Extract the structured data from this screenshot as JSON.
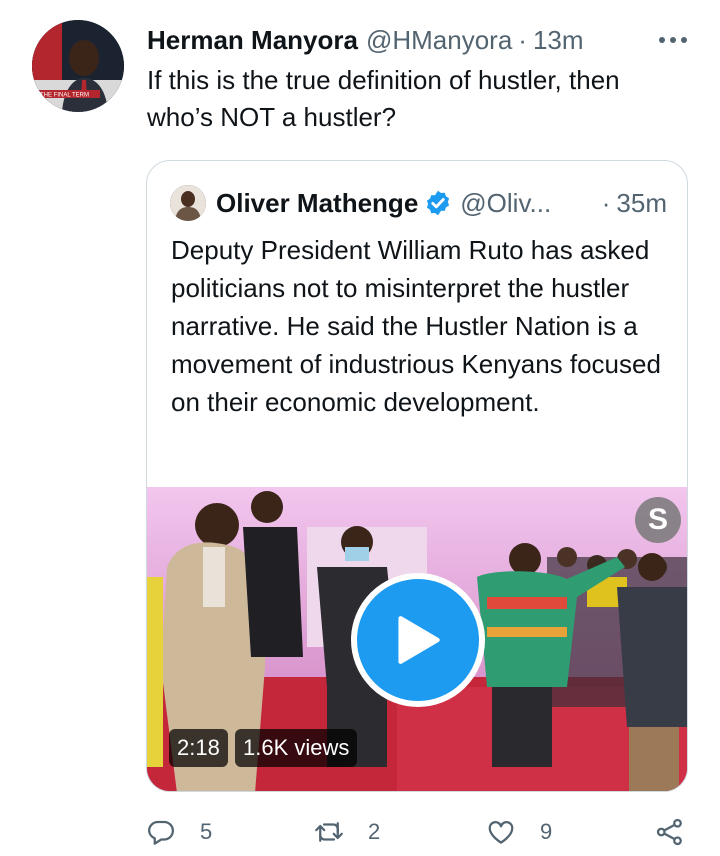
{
  "tweet": {
    "display_name": "Herman Manyora",
    "handle": "@HManyora",
    "separator": "·",
    "time": "13m",
    "text": "If this is the true definition of hustler, then who’s NOT a hustler?",
    "avatar_caption": "THE FINAL TERM"
  },
  "quote": {
    "display_name": "Oliver Mathenge",
    "handle": "@Oliv...",
    "separator": "·",
    "time": "35m",
    "text": "Deputy President William Ruto has asked politicians not to misinterpret the hustler narrative. He said the Hustler Nation is a movement of industrious Kenyans focused on their economic development.",
    "media": {
      "logo": "S",
      "duration": "2:18",
      "views": "1.6K views"
    }
  },
  "actions": {
    "reply_count": "5",
    "retweet_count": "2",
    "like_count": "9"
  },
  "icons": [
    "more-icon",
    "verified-badge-icon",
    "play-icon",
    "reply-icon",
    "retweet-icon",
    "like-icon",
    "share-icon"
  ],
  "colors": {
    "accent": "#1d9bf0",
    "text": "#0f1419",
    "secondary": "#536471",
    "border": "#cfd9de"
  }
}
